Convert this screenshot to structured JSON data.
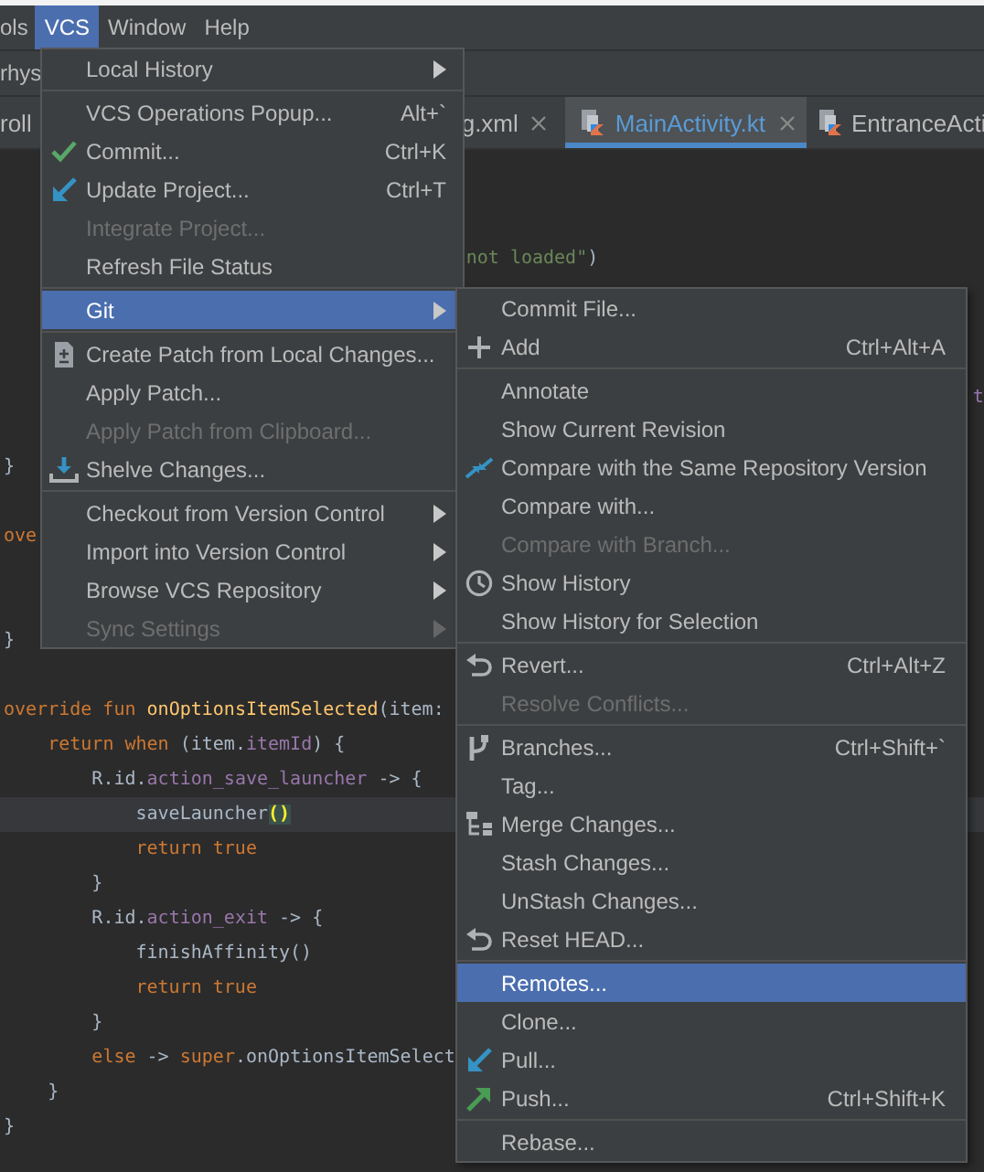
{
  "menu_bar": [
    {
      "label": "ols",
      "selected": false
    },
    {
      "label": "VCS",
      "selected": true
    },
    {
      "label": "Window",
      "selected": false
    },
    {
      "label": "Help",
      "selected": false
    }
  ],
  "toolbar": {
    "project": "rhys"
  },
  "tabs": [
    {
      "label": "roll",
      "selected": false,
      "closable": false,
      "file_icon": false
    },
    {
      "label": "g.xml",
      "selected": false,
      "closable": true,
      "file_icon": false
    },
    {
      "label": "MainActivity.kt",
      "selected": true,
      "closable": true,
      "file_icon": true
    },
    {
      "label": "EntranceActi",
      "selected": false,
      "closable": false,
      "file_icon": true
    }
  ],
  "editor": {
    "lines": [
      {
        "current": false
      },
      {
        "current": false
      },
      {
        "current": false,
        "segments": [
          {
            "text": "                                          not loaded\"",
            "kind": "string"
          },
          {
            "text": ")",
            "kind": "plain"
          }
        ]
      },
      {
        "current": false
      },
      {
        "current": false
      },
      {
        "current": false
      },
      {
        "current": false,
        "segments": [
          {
            "text": "                                                                                        t",
            "kind": "property"
          }
        ]
      },
      {
        "current": false
      },
      {
        "current": false,
        "segments": [
          {
            "text": "}",
            "kind": "plain"
          }
        ]
      },
      {
        "current": false
      },
      {
        "current": false,
        "segments": [
          {
            "text": "ove",
            "kind": "keyword"
          }
        ]
      },
      {
        "current": false
      },
      {
        "current": false
      },
      {
        "current": false,
        "segments": [
          {
            "text": "}",
            "kind": "plain"
          }
        ]
      },
      {
        "current": false
      },
      {
        "current": false,
        "segments": [
          {
            "text": "override fun ",
            "kind": "keyword"
          },
          {
            "text": "onOptionsItemSelected",
            "kind": "function"
          },
          {
            "text": "(item: ",
            "kind": "plain"
          }
        ]
      },
      {
        "current": false,
        "segments": [
          {
            "text": "    return when ",
            "kind": "keyword"
          },
          {
            "text": "(item.",
            "kind": "plain"
          },
          {
            "text": "itemId",
            "kind": "property"
          },
          {
            "text": ") {",
            "kind": "plain"
          }
        ]
      },
      {
        "current": false,
        "segments": [
          {
            "text": "        R.id.",
            "kind": "plain"
          },
          {
            "text": "action_save_launcher",
            "kind": "property"
          },
          {
            "text": " -> {",
            "kind": "plain"
          }
        ]
      },
      {
        "current": true,
        "segments": [
          {
            "text": "            saveLauncher",
            "kind": "plain"
          },
          {
            "text": "()",
            "kind": "bracket-match"
          }
        ]
      },
      {
        "current": false,
        "segments": [
          {
            "text": "            return true",
            "kind": "keyword"
          }
        ]
      },
      {
        "current": false,
        "segments": [
          {
            "text": "        }",
            "kind": "plain"
          }
        ]
      },
      {
        "current": false,
        "segments": [
          {
            "text": "        R.id.",
            "kind": "plain"
          },
          {
            "text": "action_exit",
            "kind": "property"
          },
          {
            "text": " -> {",
            "kind": "plain"
          }
        ]
      },
      {
        "current": false,
        "segments": [
          {
            "text": "            finishAffinity()",
            "kind": "plain"
          }
        ]
      },
      {
        "current": false,
        "segments": [
          {
            "text": "            return true",
            "kind": "keyword"
          }
        ]
      },
      {
        "current": false,
        "segments": [
          {
            "text": "        }",
            "kind": "plain"
          }
        ]
      },
      {
        "current": false,
        "segments": [
          {
            "text": "        else",
            "kind": "keyword"
          },
          {
            "text": " -> ",
            "kind": "plain"
          },
          {
            "text": "super",
            "kind": "keyword"
          },
          {
            "text": ".onOptionsItemSelect",
            "kind": "plain"
          }
        ]
      },
      {
        "current": false,
        "segments": [
          {
            "text": "    }",
            "kind": "plain"
          }
        ]
      },
      {
        "current": false,
        "segments": [
          {
            "text": "}",
            "kind": "plain"
          }
        ]
      }
    ]
  },
  "vcs_menu": {
    "items": [
      {
        "kind": "plain",
        "label": "Local History",
        "submenu": true,
        "disabled": false,
        "selected": false
      },
      {
        "kind": "separator"
      },
      {
        "kind": "plain",
        "label": "VCS Operations Popup...",
        "shortcut": "Alt+`",
        "submenu": false,
        "disabled": false,
        "selected": false
      },
      {
        "kind": "commit",
        "label": "Commit...",
        "shortcut": "Ctrl+K",
        "submenu": false,
        "disabled": false,
        "selected": false
      },
      {
        "kind": "update",
        "label": "Update Project...",
        "shortcut": "Ctrl+T",
        "submenu": false,
        "disabled": false,
        "selected": false
      },
      {
        "kind": "plain",
        "label": "Integrate Project...",
        "submenu": false,
        "disabled": true,
        "selected": false
      },
      {
        "kind": "plain",
        "label": "Refresh File Status",
        "submenu": false,
        "disabled": false,
        "selected": false
      },
      {
        "kind": "separator"
      },
      {
        "kind": "plain",
        "label": "Git",
        "submenu": true,
        "disabled": false,
        "selected": true
      },
      {
        "kind": "separator"
      },
      {
        "kind": "patch",
        "label": "Create Patch from Local Changes...",
        "submenu": false,
        "disabled": false,
        "selected": false
      },
      {
        "kind": "plain",
        "label": "Apply Patch...",
        "submenu": false,
        "disabled": false,
        "selected": false
      },
      {
        "kind": "plain",
        "label": "Apply Patch from Clipboard...",
        "submenu": false,
        "disabled": true,
        "selected": false
      },
      {
        "kind": "shelve",
        "label": "Shelve Changes...",
        "submenu": false,
        "disabled": false,
        "selected": false
      },
      {
        "kind": "separator"
      },
      {
        "kind": "plain",
        "label": "Checkout from Version Control",
        "submenu": true,
        "disabled": false,
        "selected": false
      },
      {
        "kind": "plain",
        "label": "Import into Version Control",
        "submenu": true,
        "disabled": false,
        "selected": false
      },
      {
        "kind": "plain",
        "label": "Browse VCS Repository",
        "submenu": true,
        "disabled": false,
        "selected": false
      },
      {
        "kind": "plain",
        "label": "Sync Settings",
        "submenu": true,
        "disabled": true,
        "selected": false
      }
    ]
  },
  "git_menu": {
    "items": [
      {
        "kind": "plain",
        "label": "Commit File...",
        "disabled": false,
        "selected": false
      },
      {
        "kind": "add",
        "label": "Add",
        "shortcut": "Ctrl+Alt+A",
        "disabled": false,
        "selected": false
      },
      {
        "kind": "separator"
      },
      {
        "kind": "plain",
        "label": "Annotate",
        "disabled": false,
        "selected": false
      },
      {
        "kind": "plain",
        "label": "Show Current Revision",
        "disabled": false,
        "selected": false
      },
      {
        "kind": "compare",
        "label": "Compare with the Same Repository Version",
        "disabled": false,
        "selected": false
      },
      {
        "kind": "plain",
        "label": "Compare with...",
        "disabled": false,
        "selected": false
      },
      {
        "kind": "plain",
        "label": "Compare with Branch...",
        "disabled": true,
        "selected": false
      },
      {
        "kind": "history",
        "label": "Show History",
        "disabled": false,
        "selected": false
      },
      {
        "kind": "plain",
        "label": "Show History for Selection",
        "disabled": false,
        "selected": false
      },
      {
        "kind": "separator"
      },
      {
        "kind": "revert",
        "label": "Revert...",
        "shortcut": "Ctrl+Alt+Z",
        "disabled": false,
        "selected": false
      },
      {
        "kind": "plain",
        "label": "Resolve Conflicts...",
        "disabled": true,
        "selected": false
      },
      {
        "kind": "separator"
      },
      {
        "kind": "branches",
        "label": "Branches...",
        "shortcut": "Ctrl+Shift+`",
        "disabled": false,
        "selected": false
      },
      {
        "kind": "plain",
        "label": "Tag...",
        "disabled": false,
        "selected": false
      },
      {
        "kind": "merge",
        "label": "Merge Changes...",
        "disabled": false,
        "selected": false
      },
      {
        "kind": "plain",
        "label": "Stash Changes...",
        "disabled": false,
        "selected": false
      },
      {
        "kind": "plain",
        "label": "UnStash Changes...",
        "disabled": false,
        "selected": false
      },
      {
        "kind": "revert",
        "label": "Reset HEAD...",
        "disabled": false,
        "selected": false
      },
      {
        "kind": "separator"
      },
      {
        "kind": "plain",
        "label": "Remotes...",
        "disabled": false,
        "selected": true
      },
      {
        "kind": "plain",
        "label": "Clone...",
        "disabled": false,
        "selected": false
      },
      {
        "kind": "pull",
        "label": "Pull...",
        "disabled": false,
        "selected": false
      },
      {
        "kind": "push",
        "label": "Push...",
        "shortcut": "Ctrl+Shift+K",
        "disabled": false,
        "selected": false
      },
      {
        "kind": "separator"
      },
      {
        "kind": "plain",
        "label": "Rebase...",
        "disabled": false,
        "selected": false
      }
    ]
  }
}
